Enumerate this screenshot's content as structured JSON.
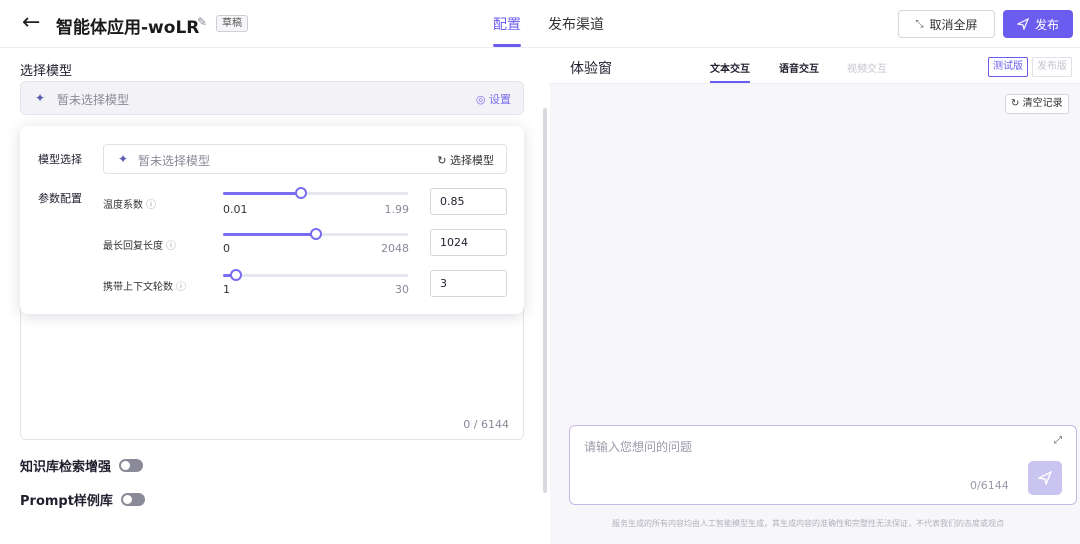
{
  "header": {
    "back_icon": "back-arrow-icon",
    "title": "智能体应用-woLR",
    "edit_icon": "edit-icon",
    "status_badge": "草稿",
    "tabs": [
      {
        "label": "配置",
        "active": true
      },
      {
        "label": "发布渠道",
        "active": false
      }
    ],
    "exit_fullscreen_label": "取消全屏",
    "publish_label": "发布",
    "accent_color": "#6b5cf0"
  },
  "left": {
    "select_model_title": "选择模型",
    "model_placeholder": "暂未选择模型",
    "settings_label": "◎ 设置",
    "popup": {
      "model_label": "模型选择",
      "model_placeholder": "暂未选择模型",
      "select_model_label": "选择模型",
      "params_label": "参数配置",
      "params": [
        {
          "name": "温度系数",
          "min": "0.01",
          "max": "1.99",
          "value": "0.85",
          "fraction": 0.42
        },
        {
          "name": "最长回复长度",
          "min": "0",
          "max": "2048",
          "value": "1024",
          "fraction": 0.5
        },
        {
          "name": "携带上下文轮数",
          "min": "1",
          "max": "30",
          "value": "3",
          "fraction": 0.07
        }
      ]
    },
    "prompt_count": "0 / 6144",
    "toggles": [
      {
        "label": "知识库检索增强",
        "on": false
      },
      {
        "label": "Prompt样例库",
        "on": false
      }
    ]
  },
  "right": {
    "title": "体验窗",
    "tabs": [
      {
        "label": "文本交互",
        "active": true
      },
      {
        "label": "语音交互",
        "active": false
      },
      {
        "label": "视频交互",
        "disabled": true
      }
    ],
    "versions": [
      {
        "label": "测试版",
        "active": true
      },
      {
        "label": "发布版",
        "active": false
      }
    ],
    "clear_label": "清空记录",
    "input_placeholder": "请输入您想问的问题",
    "input_count": "0/6144",
    "disclaimer": "服务生成的所有内容均由人工智能模型生成，其生成内容的准确性和完整性无法保证，不代表我们的态度或观点"
  }
}
